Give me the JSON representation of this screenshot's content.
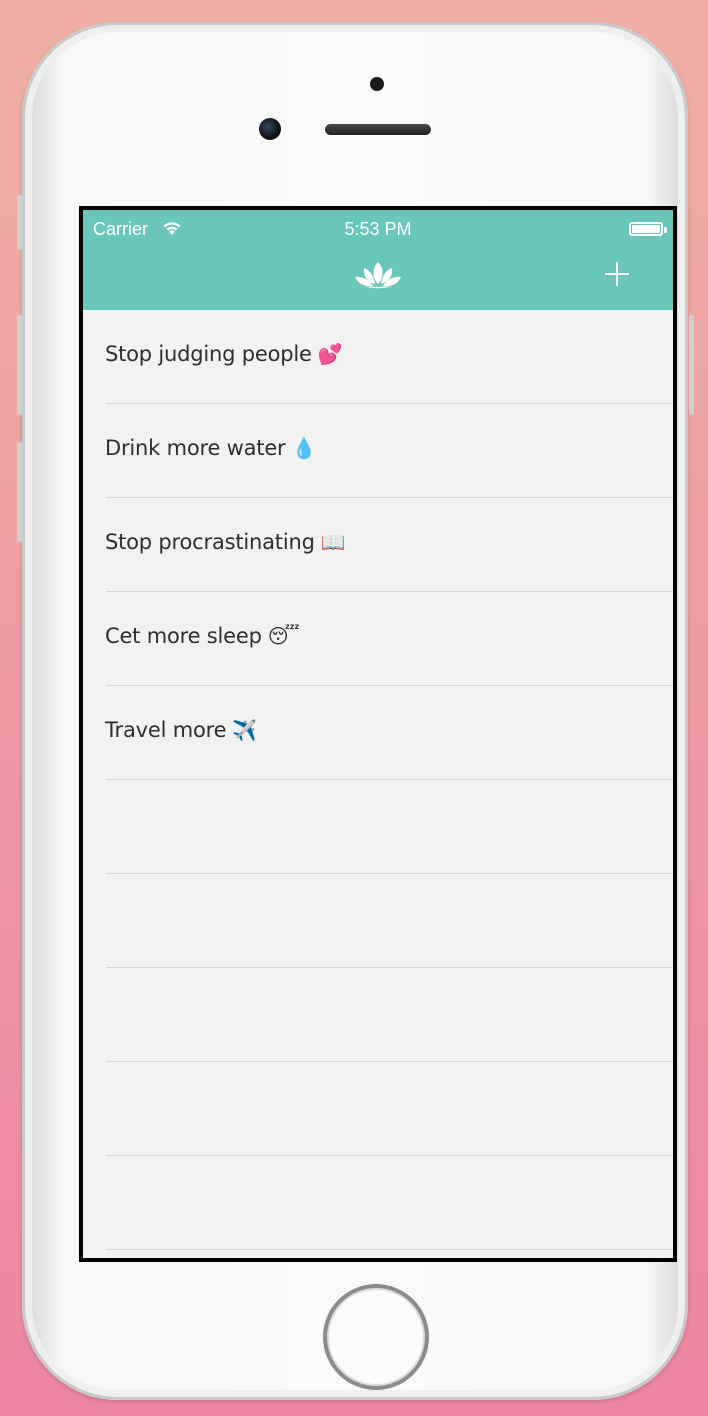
{
  "status": {
    "carrier": "Carrier",
    "time": "5:53 PM"
  },
  "navbar": {
    "logo_icon": "lotus-icon",
    "add_icon": "plus-icon",
    "color": "#6bc6ba"
  },
  "goals": [
    {
      "text": "Stop judging people",
      "emoji": "💕"
    },
    {
      "text": "Drink more water",
      "emoji": "💧"
    },
    {
      "text": "Stop procrastinating",
      "emoji": "📖"
    },
    {
      "text": "Cet more sleep",
      "emoji": "😴"
    },
    {
      "text": "Travel more",
      "emoji": "✈️"
    },
    {
      "text": "",
      "emoji": ""
    },
    {
      "text": "",
      "emoji": ""
    },
    {
      "text": "",
      "emoji": ""
    },
    {
      "text": "",
      "emoji": ""
    },
    {
      "text": "",
      "emoji": ""
    }
  ]
}
